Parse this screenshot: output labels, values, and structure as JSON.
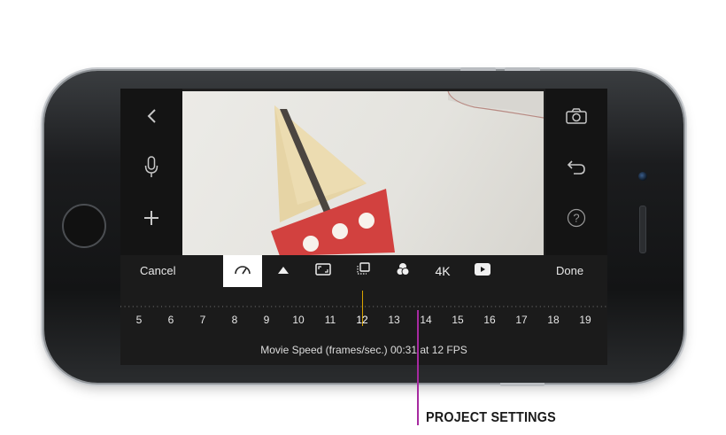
{
  "toolbar": {
    "cancel_label": "Cancel",
    "done_label": "Done",
    "items": [
      {
        "icon": "speedometer-icon",
        "active": true
      },
      {
        "icon": "triangle-up-icon",
        "active": false
      },
      {
        "icon": "aspect-ratio-icon",
        "active": false
      },
      {
        "icon": "layers-icon",
        "active": false
      },
      {
        "icon": "color-filter-icon",
        "active": false
      },
      {
        "icon": "resolution",
        "label": "4K",
        "active": false
      },
      {
        "icon": "play-icon",
        "active": false
      }
    ]
  },
  "left_bar": {
    "icons": [
      "back-chevron-icon",
      "microphone-icon",
      "plus-icon"
    ]
  },
  "right_bar": {
    "icons": [
      "camera-icon",
      "undo-icon",
      "help-icon"
    ]
  },
  "ruler": {
    "labels": [
      "5",
      "6",
      "7",
      "8",
      "9",
      "10",
      "11",
      "12",
      "13",
      "14",
      "15",
      "16",
      "17",
      "18",
      "19"
    ],
    "selected": "12",
    "indicator_color": "#d9a300"
  },
  "status": {
    "text": "Movie Speed (frames/sec.) 00:31 at 12 FPS"
  },
  "callout": {
    "text": "PROJECT SETTINGS",
    "color": "#a62aa0"
  }
}
